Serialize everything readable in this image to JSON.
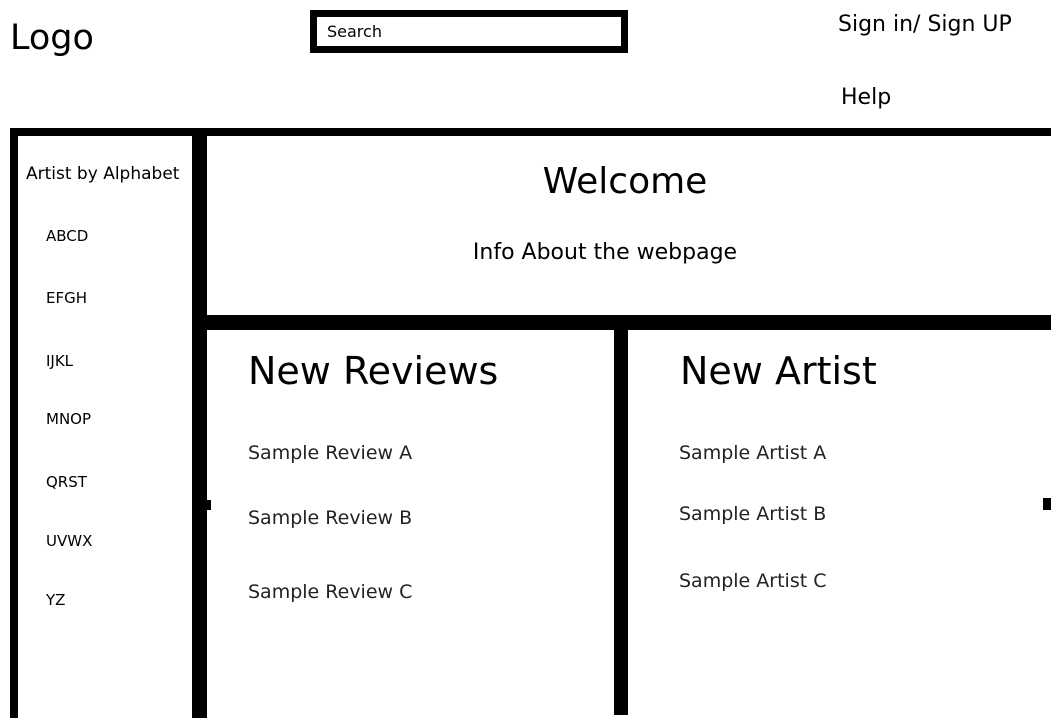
{
  "header": {
    "logo": "Logo",
    "search_placeholder": "Search",
    "signin_label": "Sign in/ Sign UP",
    "help_label": "Help"
  },
  "sidebar": {
    "title": "Artist by Alphabet",
    "letters": [
      "ABCD",
      "EFGH",
      "IJKL",
      "MNOP",
      "QRST",
      "UVWX",
      "YZ"
    ]
  },
  "welcome": {
    "title": "Welcome",
    "info": "Info About the webpage"
  },
  "new_reviews": {
    "heading": "New Reviews",
    "items": [
      "Sample Review A",
      "Sample Review B",
      "Sample Review C"
    ]
  },
  "new_artist": {
    "heading": "New Artist",
    "items": [
      "Sample Artist A",
      "Sample Artist B",
      "Sample Artist C"
    ]
  }
}
